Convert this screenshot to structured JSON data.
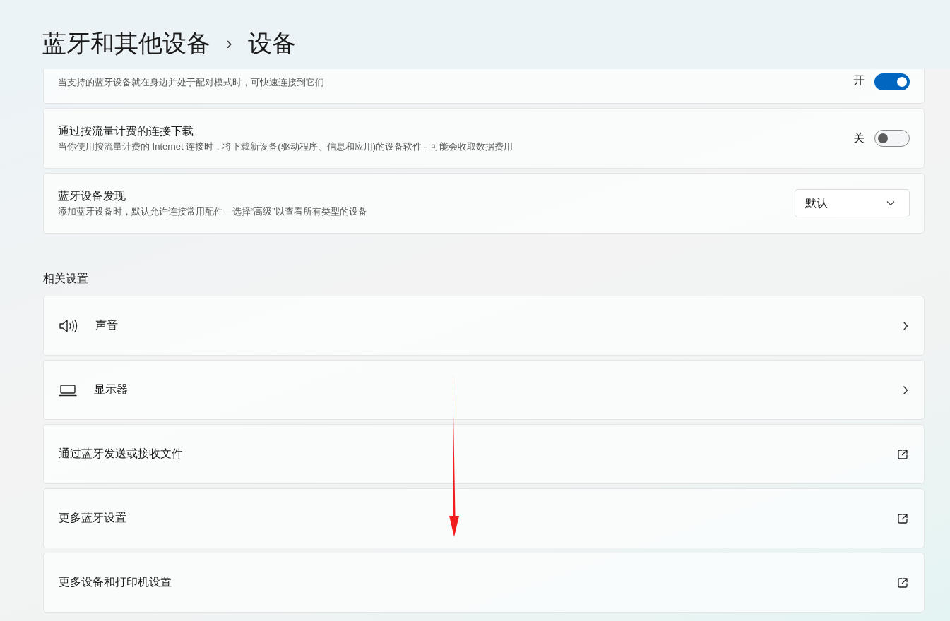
{
  "header": {
    "parent": "蓝牙和其他设备",
    "separator": "›",
    "current": "设备"
  },
  "settings": [
    {
      "kind": "toggle",
      "description": "当支持的蓝牙设备就在身边并处于配对模式时，可快速连接到它们",
      "state_label": "开",
      "on": true
    },
    {
      "kind": "toggle",
      "title": "通过按流量计费的连接下载",
      "description": "当你使用按流量计费的 Internet 连接时，将下载新设备(驱动程序、信息和应用)的设备软件 - 可能会收取数据费用",
      "state_label": "关",
      "on": false
    },
    {
      "kind": "dropdown",
      "title": "蓝牙设备发现",
      "description": "添加蓝牙设备时，默认允许连接常用配件—选择“高级”以查看所有类型的设备",
      "value": "默认"
    }
  ],
  "related": {
    "heading": "相关设置",
    "items": [
      {
        "kind": "sound",
        "label": "声音"
      },
      {
        "kind": "display",
        "label": "显示器"
      },
      {
        "kind": "external",
        "label": "通过蓝牙发送或接收文件"
      },
      {
        "kind": "external",
        "label": "更多蓝牙设置"
      },
      {
        "kind": "external",
        "label": "更多设备和打印机设置"
      }
    ]
  }
}
